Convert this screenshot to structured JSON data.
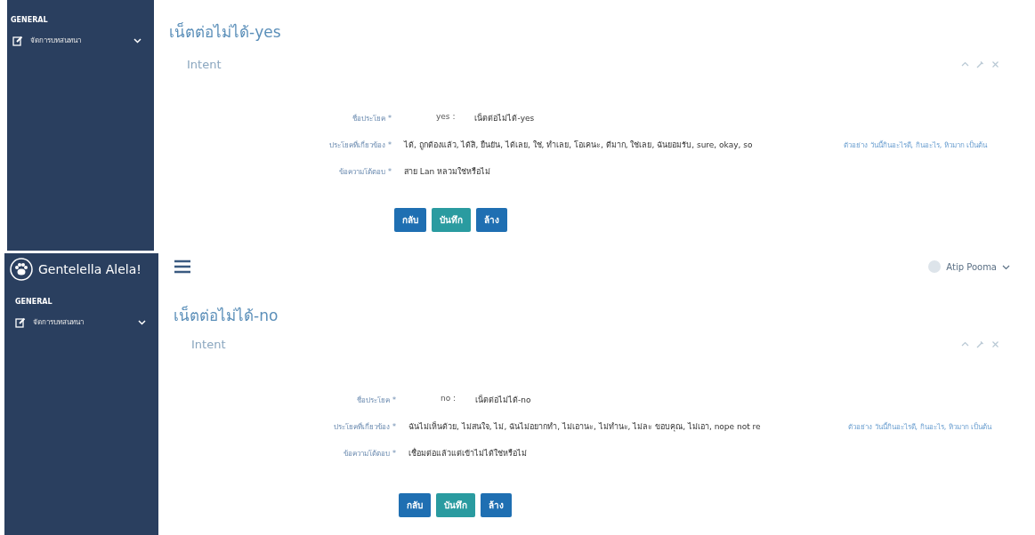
{
  "panels": [
    {
      "sidebar": {
        "section": "GENERAL",
        "menu_item": "จัดการบทสนทนา"
      },
      "title": "เน็ตต่อไม่ได้-yes",
      "subtitle": "Intent",
      "fields": [
        {
          "label": "ชื่อประโยค *",
          "prefix": "yes :",
          "value": "เน็ตต่อไม่ได้-yes"
        },
        {
          "label": "ประโยคที่เกี่ยวข้อง *",
          "value": "ได้, ถูกต้องแล้ว, ได้สิ, ยืนยัน, ได้เลย, ใช่, ทำเลย, โอเคนะ, ดีมาก, ใช่เลย, ฉันยอมรับ, sure, okay, so",
          "hint": "ตัวอย่าง วันนี้กินอะไรดี, กินอะไร, หิวมาก เป็นต้น"
        },
        {
          "label": "ข้อความโต้ตอบ *",
          "value": "สาย Lan หลวมใช่หรือไม่"
        }
      ],
      "buttons": [
        {
          "label": "กลับ",
          "kind": "primary"
        },
        {
          "label": "บันทึก",
          "kind": "success"
        },
        {
          "label": "ล้าง",
          "kind": "primary"
        }
      ]
    },
    {
      "brand": "Gentelella Alela!",
      "user": "Atip Pooma",
      "sidebar": {
        "section": "GENERAL",
        "menu_item": "จัดการบทสนทนา"
      },
      "title": "เน็ตต่อไม่ได้-no",
      "subtitle": "Intent",
      "fields": [
        {
          "label": "ชื่อประโยค *",
          "prefix": "no :",
          "value": "เน็ตต่อไม่ได้-no"
        },
        {
          "label": "ประโยคที่เกี่ยวข้อง *",
          "value": "ฉันไม่เห็นด้วย, ไม่สนใจ, ไม่, ฉันไม่อยากทำ, ไม่เอานะ, ไม่ทำนะ, ไม่ละ ขอบคุณ, ไม่เอา, nope not re",
          "hint": "ตัวอย่าง วันนี้กินอะไรดี, กินอะไร, หิวมาก เป็นต้น"
        },
        {
          "label": "ข้อความโต้ตอบ *",
          "value": "เชื่อมต่อแล้วแต่เข้าไม่ได้ใช่หรือไม่"
        }
      ],
      "buttons": [
        {
          "label": "กลับ",
          "kind": "primary"
        },
        {
          "label": "บันทึก",
          "kind": "success"
        },
        {
          "label": "ล้าง",
          "kind": "primary"
        }
      ]
    }
  ]
}
